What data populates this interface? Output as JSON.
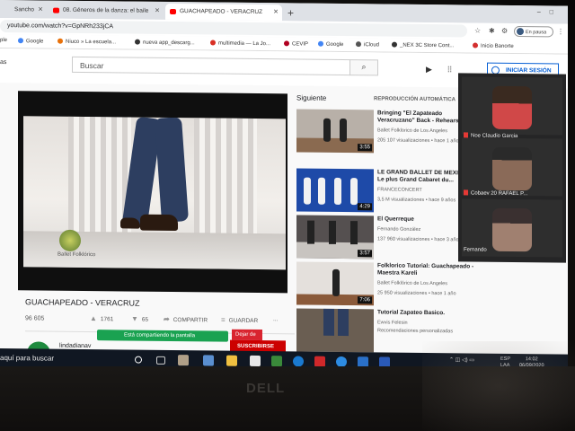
{
  "browser": {
    "tabs": [
      {
        "label": "Sancho",
        "active": false
      },
      {
        "label": "08. Géneros de la danza: el baile",
        "active": false
      },
      {
        "label": "GUACHAPEADO - VERACRUZ",
        "active": true
      }
    ],
    "new_tab": "+",
    "url": "youtube.com/watch?v=GpNRh233jCA",
    "profile_label": "En pausa",
    "bookmarks": [
      {
        "label": "ple",
        "color": "#888888"
      },
      {
        "label": "Google",
        "color": "#4285f4"
      },
      {
        "label": "Niuco » La escuela...",
        "color": "#e8710a"
      },
      {
        "label": "nueva app_descarg...",
        "color": "#333333"
      },
      {
        "label": "multimedia — La Jo...",
        "color": "#d93025"
      },
      {
        "label": "CEVIP",
        "color": "#b00020"
      },
      {
        "label": "Google",
        "color": "#4285f4"
      },
      {
        "label": "iCloud",
        "color": "#555555"
      },
      {
        "label": "_NEX 3C Store Cont...",
        "color": "#333333"
      },
      {
        "label": "Inicio Banorte",
        "color": "#d32f2f"
      }
    ]
  },
  "youtube": {
    "search_placeholder": "Buscar",
    "sign_in": "INICIAR SESIÓN",
    "video": {
      "title": "GUACHAPEADO - VERACRUZ",
      "views": "96 605",
      "likes": "1761",
      "dislikes": "65",
      "share": "COMPARTIR",
      "save": "GUARDAR",
      "more": "...",
      "watermark": "Ballet Folklórico"
    },
    "channel": "lindadianav",
    "subscribe": "SUSCRIBIRSE",
    "up_next": "Siguiente",
    "autoplay": "REPRODUCCIÓN AUTOMÁTICA",
    "recommendations": [
      {
        "title": "Bringing \"El Zapateado Veracruzano\" Back - Rehearsal",
        "channel": "Ballet Folklorico de Los Angeles",
        "meta": "205 107 visualizaciones • hace 1 año",
        "duration": "3:55",
        "thumb_color": "#b8b0a8"
      },
      {
        "title": "LE GRAND BALLET DE MEXICO - Le plus Grand Cabaret du...",
        "channel": "FRANCECONCERT",
        "meta": "3,5 M visualizaciones • hace 9 años",
        "duration": "4:29",
        "thumb_color": "#1e4aa8"
      },
      {
        "title": "El Querreque",
        "channel": "Fernando González",
        "meta": "137 960 visualizaciones • hace 3 años",
        "duration": "3:57",
        "thumb_color": "#555050"
      },
      {
        "title": "Folklorico Tutorial: Guachapeado - Maestra Kareli",
        "channel": "Ballet Folklórico de Los Angeles",
        "meta": "25 950 visualizaciones • hace 1 año",
        "duration": "7:06",
        "thumb_color": "#8a7a6e"
      },
      {
        "title": "Tutorial Zapateo Basico.",
        "channel": "Ewvis Felesin",
        "meta": "Recomendaciones personalizadas",
        "duration": "",
        "thumb_color": "#6a5e52"
      }
    ]
  },
  "meeting": {
    "participants": [
      {
        "name": "Noe Claudio Garcia",
        "face_color": "#d04848"
      },
      {
        "name": "Cobaev 20 RAFAEL P...",
        "face_color": "#8a6a58"
      },
      {
        "name": "Fernando",
        "face_color": "#a08070"
      }
    ],
    "share_status": "Está compartiendo la pantalla",
    "stop_share": "Dejar de"
  },
  "taskbar": {
    "search": "aquí para buscar",
    "lang": "ESP\nLAA",
    "time": "14:02",
    "date": "06/09/2020"
  },
  "monitor_brand": "DELL"
}
